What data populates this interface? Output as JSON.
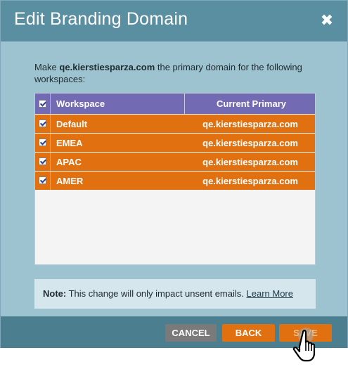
{
  "dialog": {
    "title": "Edit Branding Domain",
    "close_label": "✖",
    "intro_prefix": "Make ",
    "domain": "qe.kierstiesparza.com",
    "intro_suffix": " the primary domain for the following workspaces:"
  },
  "grid": {
    "header_checked": true,
    "columns": [
      "Workspace",
      "Current Primary"
    ],
    "rows": [
      {
        "workspace": "Default",
        "primary": "qe.kierstiesparza.com",
        "checked": true
      },
      {
        "workspace": "EMEA",
        "primary": "qe.kierstiesparza.com",
        "checked": true
      },
      {
        "workspace": "APAC",
        "primary": "qe.kierstiesparza.com",
        "checked": true
      },
      {
        "workspace": "AMER",
        "primary": "qe.kierstiesparza.com",
        "checked": true
      }
    ]
  },
  "note": {
    "label": "Note:",
    "text": " This change will only impact unsent emails. ",
    "link": "Learn More"
  },
  "footer": {
    "cancel_label": "CANCEL",
    "back_label": "BACK",
    "save_label": "SAVE"
  },
  "colors": {
    "title_bar": "#5a8fa1",
    "dialog_body": "#9dc3d0",
    "grid_header": "#726bb3",
    "row_selected": "#e07010",
    "footer_bar": "#4b7e8f",
    "cancel_button": "#7a7a7a",
    "primary_button": "#e07010"
  },
  "icons": {
    "close": "close-icon",
    "checkbox": "checkbox-checked-icon",
    "cursor": "hand-pointer-cursor-icon"
  }
}
